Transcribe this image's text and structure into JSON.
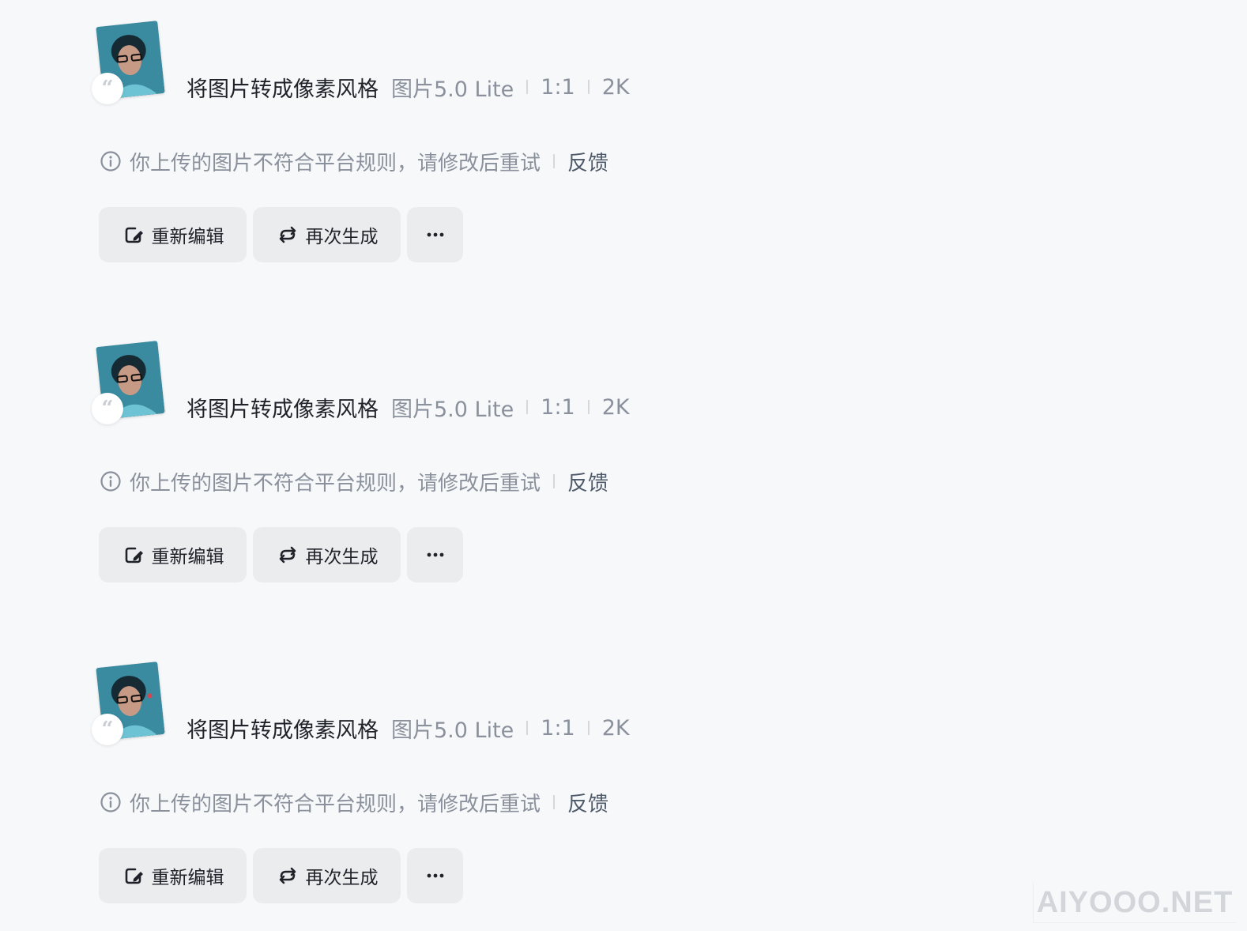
{
  "records": [
    {
      "prompt": "将图片转成像素风格",
      "model": "图片5.0 Lite",
      "ratio": "1:1",
      "resolution": "2K",
      "notice": "你上传的图片不符合平台规则，请修改后重试",
      "feedback": "反馈",
      "actions": {
        "edit": "重新编辑",
        "regenerate": "再次生成",
        "more": "···"
      },
      "quote_glyph": "“"
    },
    {
      "prompt": "将图片转成像素风格",
      "model": "图片5.0 Lite",
      "ratio": "1:1",
      "resolution": "2K",
      "notice": "你上传的图片不符合平台规则，请修改后重试",
      "feedback": "反馈",
      "actions": {
        "edit": "重新编辑",
        "regenerate": "再次生成",
        "more": "···"
      },
      "quote_glyph": "“"
    },
    {
      "prompt": "将图片转成像素风格",
      "model": "图片5.0 Lite",
      "ratio": "1:1",
      "resolution": "2K",
      "notice": "你上传的图片不符合平台规则，请修改后重试",
      "feedback": "反馈",
      "actions": {
        "edit": "重新编辑",
        "regenerate": "再次生成",
        "more": "···"
      },
      "quote_glyph": "“"
    }
  ],
  "icons": {
    "info": "info-circle-icon",
    "edit": "edit-square-icon",
    "regenerate": "refresh-icon",
    "more": "more-dots-icon",
    "quote": "quote-icon"
  },
  "colors": {
    "background": "#f7f8fa",
    "button_bg": "#ebecee",
    "muted_text": "#8a919c",
    "primary_text": "#1f2329"
  },
  "watermark": "AIYOOO.NET"
}
